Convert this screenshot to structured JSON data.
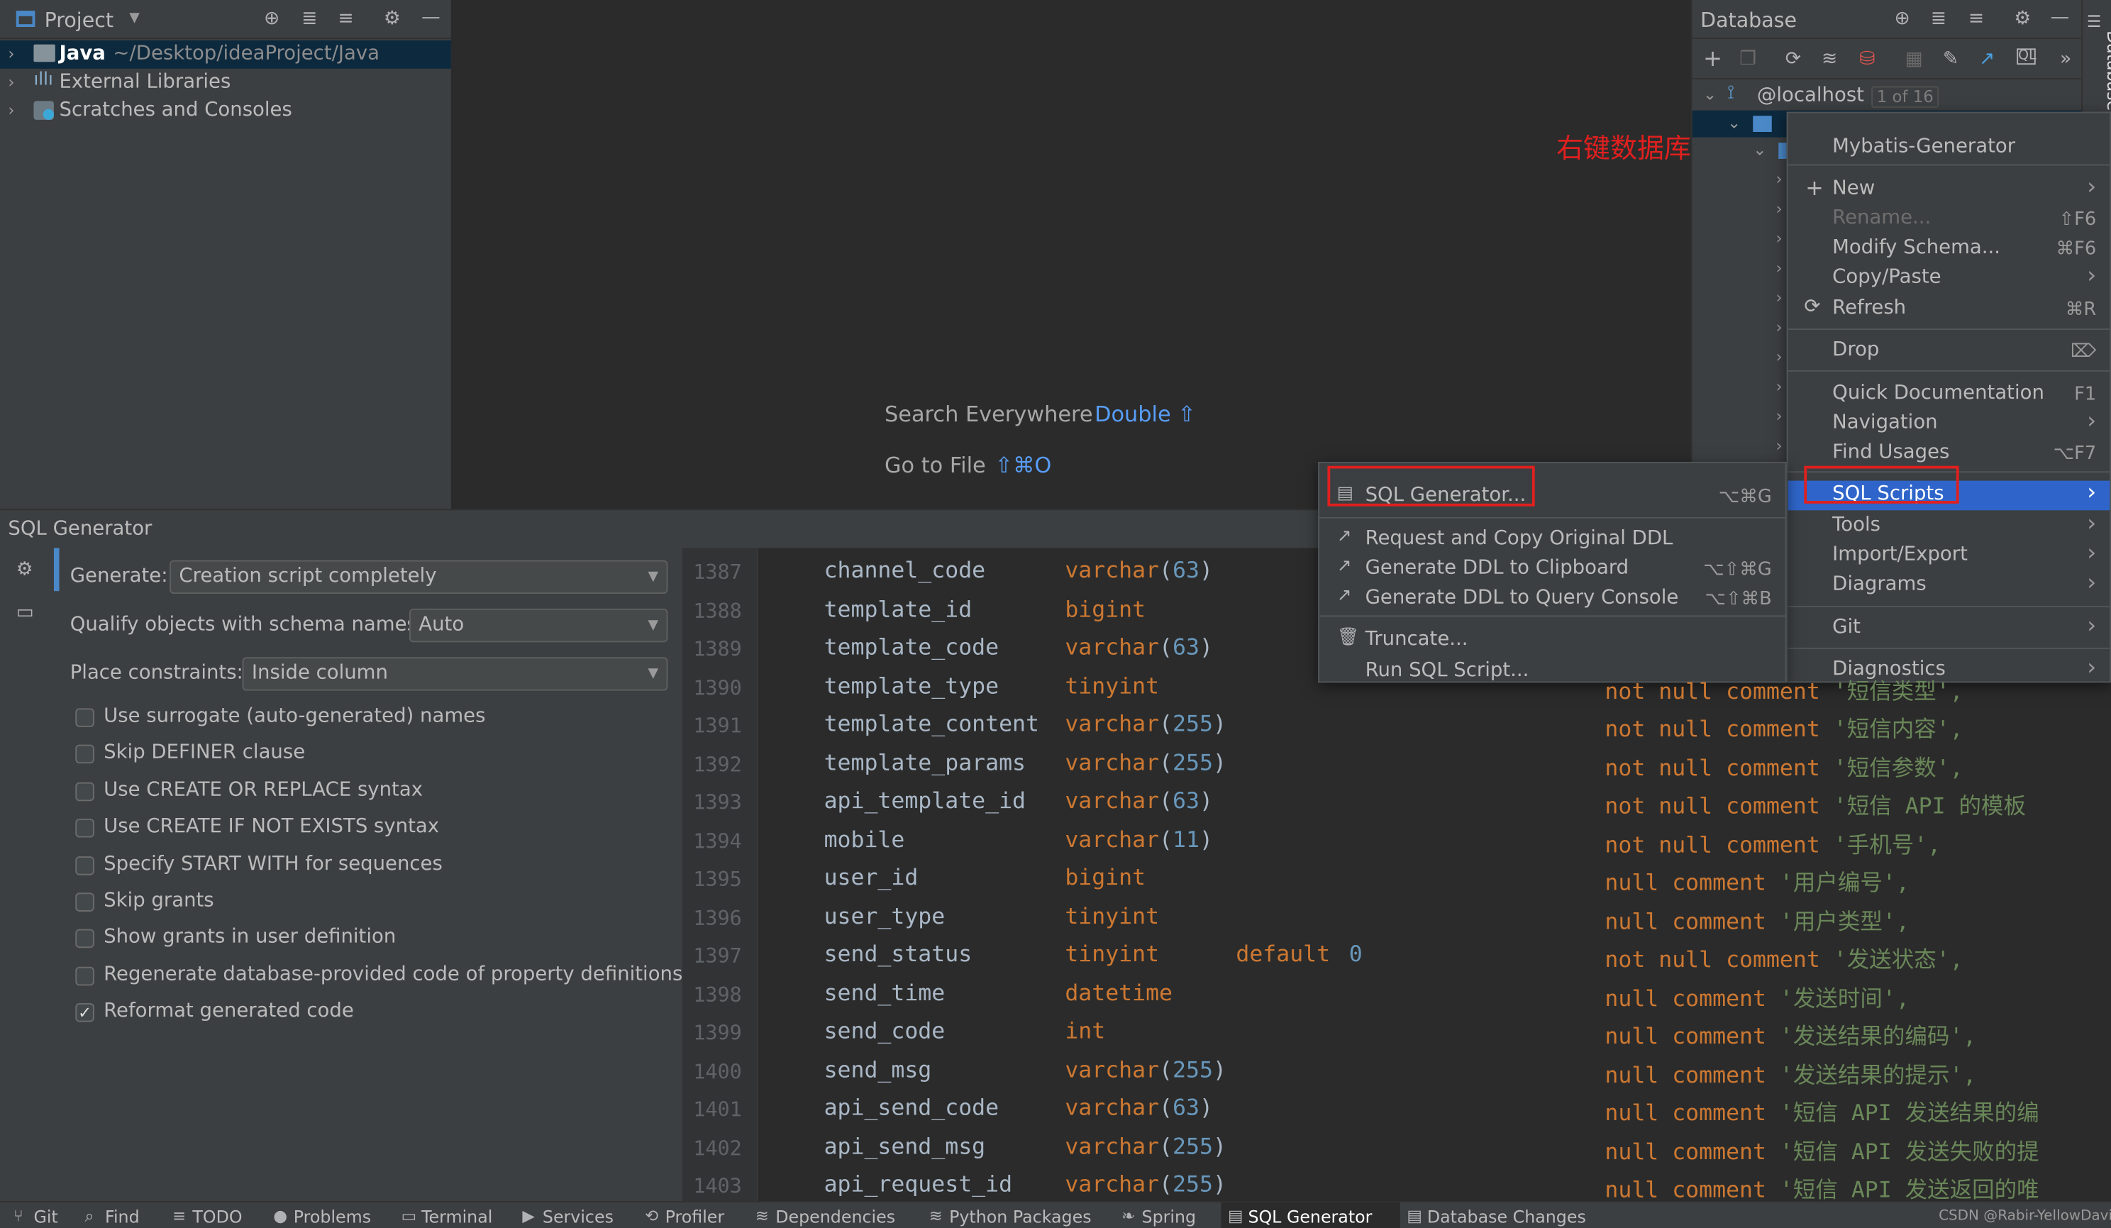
{
  "project_panel": {
    "title": "Project",
    "tree": [
      {
        "name": "Java",
        "path": "~/Desktop/ideaProject/Java"
      },
      {
        "name": "External Libraries"
      },
      {
        "name": "Scratches and Consoles"
      }
    ]
  },
  "editor_hints": {
    "search_everywhere": "Search Everywhere",
    "search_everywhere_key": "Double ⇧",
    "go_to_file": "Go to File",
    "go_to_file_key": "⇧⌘O"
  },
  "database_panel": {
    "title": "Database",
    "side_tab": "Database",
    "root": "@localhost",
    "root_badge": "1 of 16"
  },
  "annotation": "右键数据库",
  "context_menu": [
    {
      "label": "Mybatis-Generator",
      "shortcut": ""
    },
    {
      "label": "New",
      "shortcut": "›"
    },
    {
      "label": "Rename...",
      "shortcut": "⇧F6"
    },
    {
      "label": "Modify Schema...",
      "shortcut": "⌘F6"
    },
    {
      "label": "Copy/Paste",
      "shortcut": "›"
    },
    {
      "label": "Refresh",
      "shortcut": "⌘R"
    },
    {
      "label": "Drop",
      "shortcut": "⌦"
    },
    {
      "label": "Quick Documentation",
      "shortcut": "F1"
    },
    {
      "label": "Navigation",
      "shortcut": "›"
    },
    {
      "label": "Find Usages",
      "shortcut": "⌥F7"
    },
    {
      "label": "SQL Scripts",
      "shortcut": "›"
    },
    {
      "label": "Tools",
      "shortcut": "›"
    },
    {
      "label": "Import/Export",
      "shortcut": "›"
    },
    {
      "label": "Diagrams",
      "shortcut": "›"
    },
    {
      "label": "Git",
      "shortcut": "›"
    },
    {
      "label": "Diagnostics",
      "shortcut": "›"
    }
  ],
  "submenu": [
    {
      "label": "SQL Generator...",
      "shortcut": "⌥⌘G"
    },
    {
      "label": "Request and Copy Original DDL",
      "shortcut": ""
    },
    {
      "label": "Generate DDL to Clipboard",
      "shortcut": "⌥⇧⌘G"
    },
    {
      "label": "Generate DDL to Query Console",
      "shortcut": "⌥⇧⌘B"
    },
    {
      "label": "Truncate...",
      "shortcut": ""
    },
    {
      "label": "Run SQL Script...",
      "shortcut": ""
    }
  ],
  "sql_generator": {
    "title": "SQL Generator",
    "generate_label": "Generate:",
    "generate_value": "Creation script completely",
    "qualify_label": "Qualify objects with schema names:",
    "qualify_value": "Auto",
    "place_label": "Place constraints:",
    "place_value": "Inside column",
    "options": [
      {
        "label": "Use surrogate (auto-generated) names",
        "checked": false
      },
      {
        "label": "Skip DEFINER clause",
        "checked": false
      },
      {
        "label": "Use CREATE OR REPLACE syntax",
        "checked": false
      },
      {
        "label": "Use CREATE IF NOT EXISTS syntax",
        "checked": false
      },
      {
        "label": "Specify START WITH for sequences",
        "checked": false
      },
      {
        "label": "Skip grants",
        "checked": false
      },
      {
        "label": "Show grants in user definition",
        "checked": false
      },
      {
        "label": "Regenerate database-provided code of property definitions",
        "checked": false
      },
      {
        "label": "Reformat generated code",
        "checked": true
      }
    ]
  },
  "code_lines": [
    {
      "n": "1387",
      "field": "channel_code",
      "type": "varchar",
      "len": "63",
      "tail": ""
    },
    {
      "n": "1388",
      "field": "template_id",
      "type": "bigint",
      "len": "",
      "tail": ""
    },
    {
      "n": "1389",
      "field": "template_code",
      "type": "varchar",
      "len": "63",
      "tail": ""
    },
    {
      "n": "1390",
      "field": "template_type",
      "type": "tinyint",
      "len": "",
      "tail": "not null comment '短信类型',"
    },
    {
      "n": "1391",
      "field": "template_content",
      "type": "varchar",
      "len": "255",
      "tail": "not null comment '短信内容',"
    },
    {
      "n": "1392",
      "field": "template_params",
      "type": "varchar",
      "len": "255",
      "tail": "not null comment '短信参数',"
    },
    {
      "n": "1393",
      "field": "api_template_id",
      "type": "varchar",
      "len": "63",
      "tail": "not null comment '短信 API 的模板"
    },
    {
      "n": "1394",
      "field": "mobile",
      "type": "varchar",
      "len": "11",
      "tail": "not null comment '手机号',"
    },
    {
      "n": "1395",
      "field": "user_id",
      "type": "bigint",
      "len": "",
      "tail": "null comment '用户编号',"
    },
    {
      "n": "1396",
      "field": "user_type",
      "type": "tinyint",
      "len": "",
      "tail": "null comment '用户类型',"
    },
    {
      "n": "1397",
      "field": "send_status",
      "type": "tinyint",
      "len": "",
      "default": "0",
      "tail": "not null comment '发送状态',"
    },
    {
      "n": "1398",
      "field": "send_time",
      "type": "datetime",
      "len": "",
      "tail": "null comment '发送时间',"
    },
    {
      "n": "1399",
      "field": "send_code",
      "type": "int",
      "len": "",
      "tail": "null comment '发送结果的编码',"
    },
    {
      "n": "1400",
      "field": "send_msg",
      "type": "varchar",
      "len": "255",
      "tail": "null comment '发送结果的提示',"
    },
    {
      "n": "1401",
      "field": "api_send_code",
      "type": "varchar",
      "len": "63",
      "tail": "null comment '短信 API 发送结果的编"
    },
    {
      "n": "1402",
      "field": "api_send_msg",
      "type": "varchar",
      "len": "255",
      "tail": "null comment '短信 API 发送失败的提"
    },
    {
      "n": "1403",
      "field": "api_request_id",
      "type": "varchar",
      "len": "255",
      "tail": "null comment '短信 API 发送返回的唯"
    }
  ],
  "bottom_tabs": [
    "Git",
    "Find",
    "TODO",
    "Problems",
    "Terminal",
    "Services",
    "Profiler",
    "Dependencies",
    "Python Packages",
    "Spring",
    "SQL Generator",
    "Database Changes"
  ],
  "watermark": "CSDN @Rabir-YellowDavid",
  "colors": {
    "accent": "#4a88c7",
    "selection": "#2f65ca",
    "highlight_box": "#e0201f",
    "keyword": "#cc7832",
    "number": "#6897bb",
    "string": "#6a8759"
  }
}
